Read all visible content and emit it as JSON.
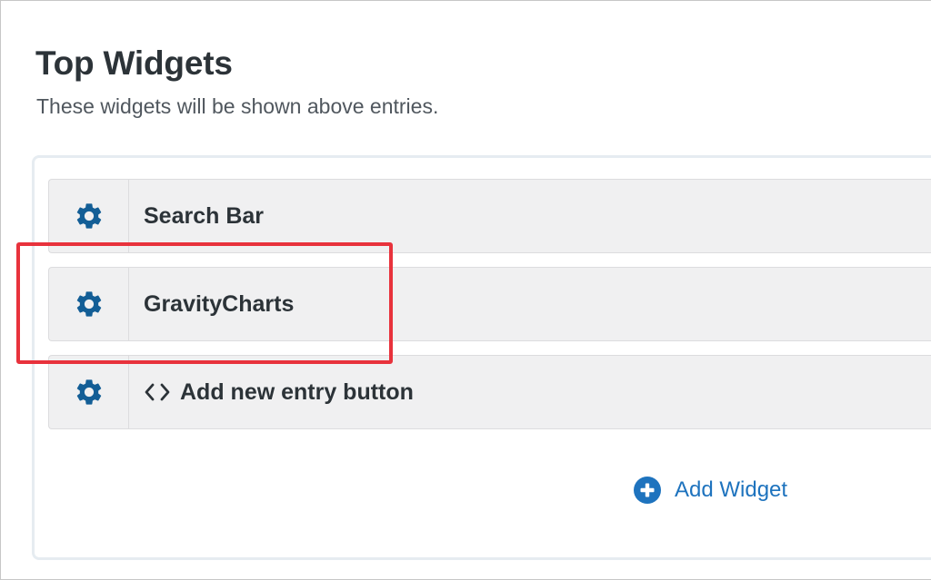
{
  "section": {
    "title": "Top Widgets",
    "subtitle": "These widgets will be shown above entries."
  },
  "widgets": [
    {
      "label": "Search Bar",
      "icon": "gear-icon"
    },
    {
      "label": "GravityCharts",
      "icon": "gear-icon",
      "highlighted": true
    },
    {
      "label": "Add new entry button",
      "icon": "gear-icon",
      "prefix_icon": "code-icon"
    }
  ],
  "add_widget": {
    "label": "Add Widget",
    "icon": "plus-circle-icon"
  },
  "colors": {
    "accent": "#1e73be",
    "gear": "#135e96",
    "highlight": "#e8323c",
    "row_bg": "#f0f0f1",
    "text": "#2c3338"
  }
}
